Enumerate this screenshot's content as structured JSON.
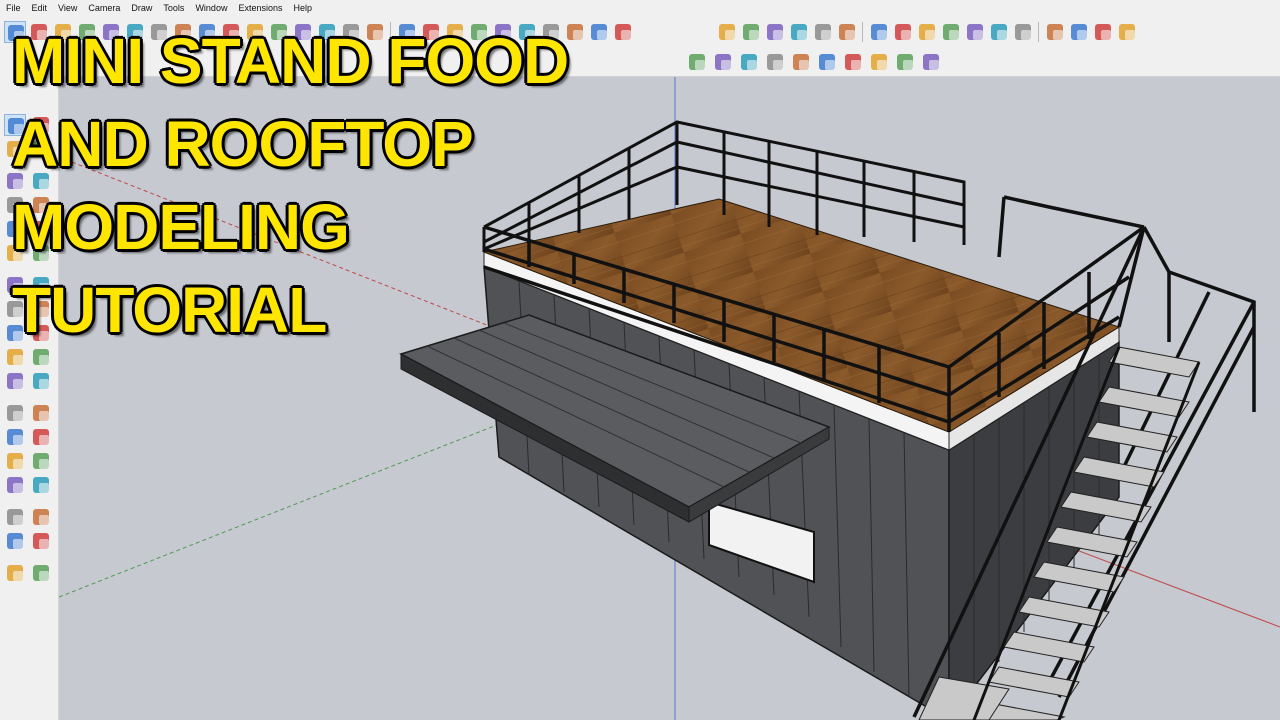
{
  "menu": [
    "File",
    "Edit",
    "View",
    "Camera",
    "Draw",
    "Tools",
    "Window",
    "Extensions",
    "Help"
  ],
  "title_lines": [
    "MINI STAND FOOD",
    "AND ROOFTOP",
    "MODELING",
    "TUTORIAL"
  ],
  "toolbar_top": {
    "group1": [
      "select-icon",
      "eraser-icon",
      "paint-bucket-icon",
      "line-icon",
      "arc-icon",
      "rectangle-icon",
      "push-pull-icon",
      "move-icon",
      "rotate-icon",
      "scale-icon",
      "offset-icon",
      "tape-measure-icon",
      "text-icon",
      "axes-icon",
      "dimension-icon",
      "protractor-icon"
    ],
    "group2": [
      "orbit-icon",
      "pan-icon",
      "zoom-icon",
      "zoom-extents-icon",
      "previous-view-icon",
      "next-view-icon",
      "camera-icon",
      "position-camera-icon",
      "look-around-icon",
      "walk-icon"
    ],
    "views": [
      "iso-view-icon",
      "top-view-icon",
      "front-view-icon",
      "right-view-icon",
      "back-view-icon",
      "left-view-icon"
    ],
    "styles": [
      "xray-icon",
      "back-edges-icon",
      "wireframe-icon",
      "hidden-line-icon",
      "shaded-icon",
      "shaded-textures-icon",
      "monochrome-icon"
    ],
    "sections": [
      "section-plane-icon",
      "display-section-planes-icon",
      "display-section-cuts-icon",
      "display-section-fill-icon"
    ]
  },
  "toolbar_second": [
    "warehouse-icon",
    "extension-warehouse-icon",
    "layout-icon",
    "sandbox-from-contours-icon",
    "sandbox-from-scratch-icon",
    "smoove-icon",
    "stamp-icon",
    "drape-icon",
    "add-detail-icon",
    "flip-edge-icon"
  ],
  "left_tools": [
    [
      "select-icon",
      "component-icon"
    ],
    [
      "paint-bucket-icon",
      "eraser-icon"
    ],
    [
      "line-icon",
      "freehand-icon"
    ],
    [
      "rectangle-icon",
      "rotated-rectangle-icon"
    ],
    [
      "circle-icon",
      "polygon-icon"
    ],
    [
      "arc-icon",
      "pie-icon"
    ],
    [
      "move-icon",
      "push-pull-icon"
    ],
    [
      "rotate-icon",
      "follow-me-icon"
    ],
    [
      "scale-icon",
      "offset-icon"
    ],
    [
      "tape-measure-icon",
      "dimension-icon"
    ],
    [
      "axes-icon",
      "3d-text-icon"
    ],
    [
      "orbit-icon",
      "pan-icon"
    ],
    [
      "zoom-icon",
      "zoom-window-icon"
    ],
    [
      "zoom-extents-icon",
      "previous-icon"
    ],
    [
      "position-camera-icon",
      "look-around-icon"
    ],
    [
      "walk-icon",
      "section-plane-icon"
    ],
    [
      "warehouse-icon",
      "extension-manager-icon"
    ],
    [
      "layers-icon",
      "sandbox-icon"
    ]
  ]
}
